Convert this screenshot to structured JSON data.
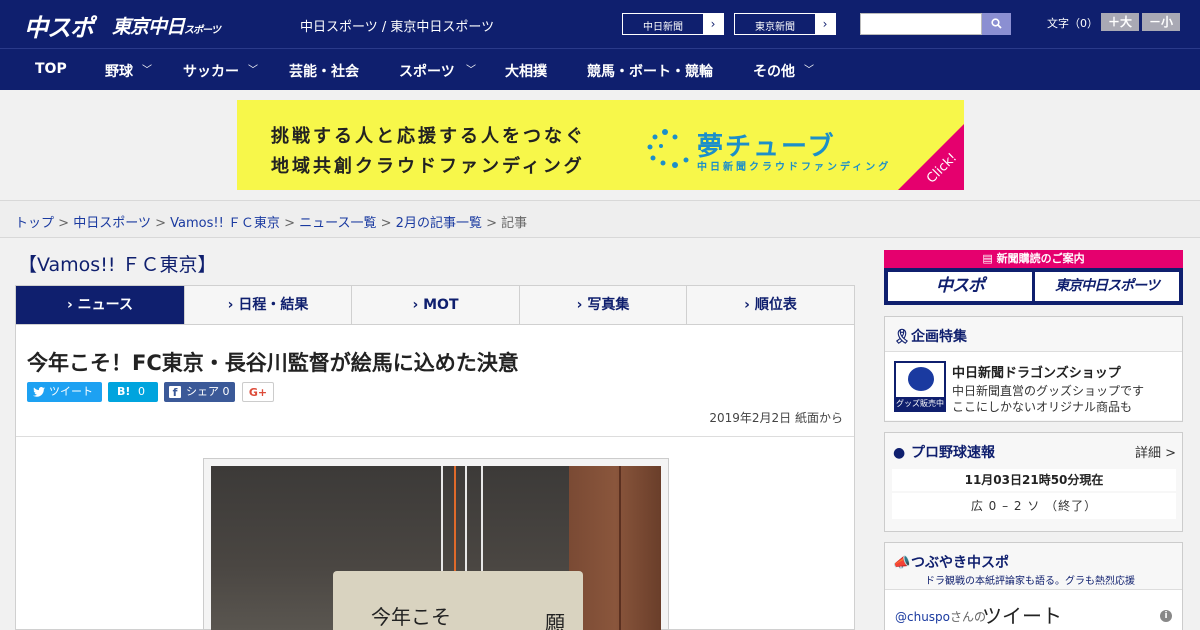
{
  "header": {
    "logo_chuspo": "中スポ",
    "logo_tokyo": "東京中日",
    "logo_tokyo_small": "スポーツ",
    "site_links": "中日スポーツ / 東京中日スポーツ",
    "paper_links": [
      "中日新聞",
      "東京新聞"
    ],
    "search_placeholder": "",
    "font_size_label": "文字（0）",
    "font_larger": "＋大",
    "font_smaller": "－小"
  },
  "nav": {
    "items": [
      {
        "label": "TOP",
        "dropdown": false
      },
      {
        "label": "野球",
        "dropdown": true
      },
      {
        "label": "サッカー",
        "dropdown": true
      },
      {
        "label": "芸能・社会",
        "dropdown": false
      },
      {
        "label": "スポーツ",
        "dropdown": true
      },
      {
        "label": "大相撲",
        "dropdown": false
      },
      {
        "label": "競馬・ボート・競輪",
        "dropdown": false
      },
      {
        "label": "その他",
        "dropdown": true
      }
    ]
  },
  "banner": {
    "line1": "挑戦する人と応援する人をつなぐ",
    "line2": "地域共創クラウドファンディング",
    "logo": "夢チューブ",
    "sub": "中日新聞クラウドファンディング",
    "click": "Click!",
    "colors": {
      "bg": "#f7f74a",
      "accent": "#1c8fc9",
      "corner": "#e5006e"
    }
  },
  "breadcrumb": {
    "links": [
      "トップ",
      "中日スポーツ",
      "Vamos!! ＦＣ東京",
      "ニュース一覧",
      "2月の記事一覧"
    ],
    "current": "記事",
    "separator": ">"
  },
  "section": {
    "title": "【Vamos!! ＦＣ東京】"
  },
  "tabs": [
    "ニュース",
    "日程・結果",
    "MOT",
    "写真集",
    "順位表"
  ],
  "article": {
    "headline": "今年こそ！FC東京・長谷川監督が絵馬に込めた決意",
    "share": {
      "tweet": "ツイート",
      "hatena": "0",
      "facebook": "シェア 0",
      "gplus": "G+"
    },
    "dateline": "2019年2月2日 紙面から",
    "ema_text1": "今年こそ",
    "ema_text2": "願"
  },
  "sidebar": {
    "subscribe_head": "新聞購読のご案内",
    "subscribe_buttons": [
      "中スポ",
      "東京中日スポーツ"
    ],
    "special": {
      "title": "企画特集",
      "item_name": "中日新聞ドラゴンズショップ",
      "item_desc1": "中日新聞直営のグッズショップです",
      "item_desc2": "ここにしかないオリジナル商品も",
      "thumb_caption": "グッズ販売中"
    },
    "baseball": {
      "title": "プロ野球速報",
      "more": "詳細 >",
      "time": "11月03日21時50分現在",
      "score": "広 0 – 2 ソ （終了）"
    },
    "tweets": {
      "title": "つぶやき中スポ",
      "subtitle": "ドラ観戦の本紙評論家も語る。グラも熱烈応援",
      "user": "@chuspo",
      "user_suffix": "さんの",
      "label": "ツイート"
    }
  },
  "theme": {
    "navy": "#0f1f6e",
    "pink": "#e5006e"
  }
}
